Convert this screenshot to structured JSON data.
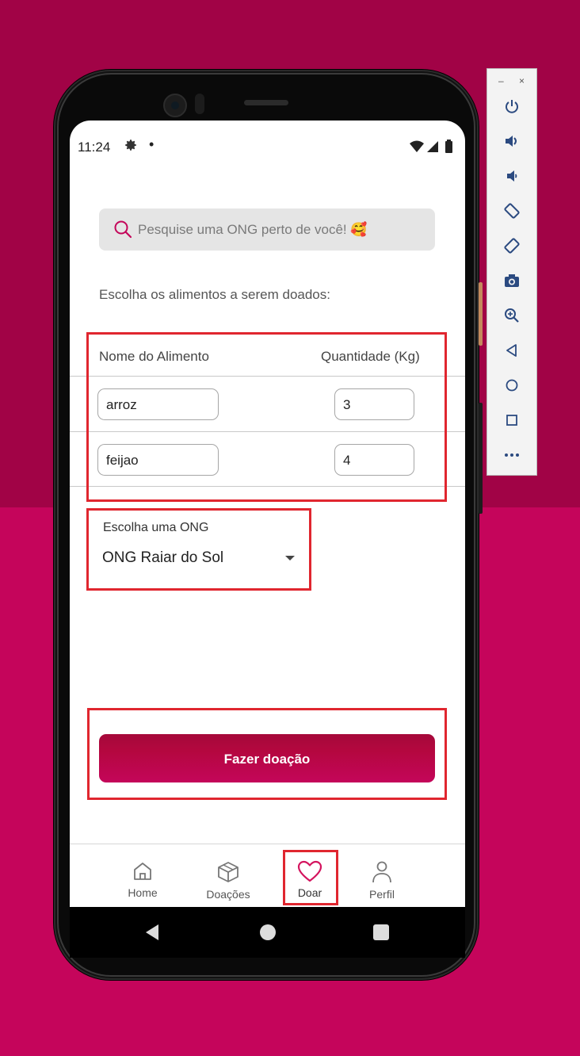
{
  "colors": {
    "background_top": "#a10346",
    "background_bottom": "#c5055b",
    "accent": "#c4065a",
    "annotation": "#e0262f"
  },
  "status_bar": {
    "time": "11:24",
    "icons": [
      "gear-icon",
      "notification-dot-icon",
      "wifi-icon",
      "signal-icon",
      "battery-icon"
    ]
  },
  "search": {
    "placeholder": "Pesquise uma ONG perto de você! 🥰",
    "icon": "search-icon"
  },
  "prompt": "Escolha os alimentos a serem doados:",
  "food_table": {
    "headers": [
      "Nome do Alimento",
      "Quantidade (Kg)"
    ],
    "rows": [
      {
        "name": "arroz",
        "quantity": "3"
      },
      {
        "name": "feijao",
        "quantity": "4"
      }
    ]
  },
  "ong_select": {
    "label": "Escolha uma ONG",
    "selected": "ONG Raiar do Sol"
  },
  "donate_button": "Fazer doação",
  "bottom_nav": [
    {
      "label": "Home",
      "icon": "home-icon"
    },
    {
      "label": "Doações",
      "icon": "box-icon"
    },
    {
      "label": "Doar",
      "icon": "heart-icon",
      "active": true
    },
    {
      "label": "Perfil",
      "icon": "person-icon"
    }
  ],
  "emulator_toolbar": {
    "window_controls": [
      "–",
      "×"
    ],
    "tools": [
      "power-icon",
      "volume-up-icon",
      "volume-down-icon",
      "rotate-left-icon",
      "rotate-right-icon",
      "camera-icon",
      "zoom-icon",
      "back-icon",
      "home-circle-icon",
      "overview-icon",
      "more-icon"
    ]
  }
}
